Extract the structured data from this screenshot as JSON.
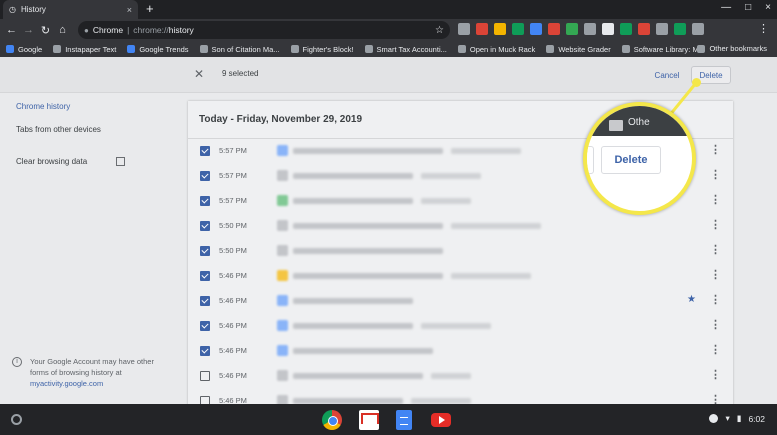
{
  "tab": {
    "title": "History",
    "close": "×",
    "new_tab": "+"
  },
  "window": {
    "controls": [
      "—",
      "□",
      "×"
    ]
  },
  "toolbar": {
    "back": "←",
    "forward": "→",
    "reload": "↻",
    "home": "⌂",
    "omnibox_label": "Chrome",
    "omnibox_scheme": "chrome://",
    "omnibox_path": "history",
    "star": "☆",
    "menu": "⋮"
  },
  "extensions": [
    "#9aa0a6",
    "#db4437",
    "#f4b400",
    "#0f9d58",
    "#4285f4",
    "#db4437",
    "#34a853",
    "#9aa0a6",
    "#e8eaed",
    "#0f9d58",
    "#db4437",
    "#9aa0a6",
    "#0f9d58",
    "#9aa0a6"
  ],
  "bookmarks": [
    {
      "label": "Google",
      "color": "#4285f4"
    },
    {
      "label": "Instapaper Text",
      "color": "#9aa0a6"
    },
    {
      "label": "Google Trends",
      "color": "#4285f4"
    },
    {
      "label": "Son of Citation Ma...",
      "color": "#9aa0a6"
    },
    {
      "label": "Fighter's Block!",
      "color": "#9aa0a6"
    },
    {
      "label": "Smart Tax Accounti...",
      "color": "#9aa0a6"
    },
    {
      "label": "Open in Muck Rack",
      "color": "#9aa0a6"
    },
    {
      "label": "Website Grader",
      "color": "#9aa0a6"
    },
    {
      "label": "Software Library: M...",
      "color": "#9aa0a6"
    }
  ],
  "other_bookmarks": "Other bookmarks",
  "selection": {
    "close": "✕",
    "count_label": "9 selected",
    "cancel": "Cancel",
    "delete": "Delete"
  },
  "sidebar": {
    "chrome_history": "Chrome history",
    "tabs_other_devices": "Tabs from other devices",
    "clear_data": "Clear browsing data",
    "account_note": "Your Google Account may have other forms of browsing history at",
    "account_link": "myactivity.google.com",
    "info_glyph": "i"
  },
  "history": {
    "date_header": "Today - Friday, November 29, 2019",
    "rows": [
      {
        "time": "5:57 PM",
        "checked": true,
        "starred": false,
        "fav": "#8ab4f8"
      },
      {
        "time": "5:57 PM",
        "checked": true,
        "starred": false,
        "fav": "#c3c5c9"
      },
      {
        "time": "5:57 PM",
        "checked": true,
        "starred": false,
        "fav": "#81c995"
      },
      {
        "time": "5:50 PM",
        "checked": true,
        "starred": false,
        "fav": "#c3c5c9"
      },
      {
        "time": "5:50 PM",
        "checked": true,
        "starred": false,
        "fav": "#c3c5c9"
      },
      {
        "time": "5:46 PM",
        "checked": true,
        "starred": false,
        "fav": "#f4c542"
      },
      {
        "time": "5:46 PM",
        "checked": true,
        "starred": true,
        "fav": "#8ab4f8"
      },
      {
        "time": "5:46 PM",
        "checked": true,
        "starred": false,
        "fav": "#8ab4f8"
      },
      {
        "time": "5:46 PM",
        "checked": true,
        "starred": false,
        "fav": "#8ab4f8"
      },
      {
        "time": "5:46 PM",
        "checked": false,
        "starred": false,
        "fav": "#c3c5c9"
      },
      {
        "time": "5:46 PM",
        "checked": false,
        "starred": false,
        "fav": "#c3c5c9"
      }
    ],
    "row_menu": "⋮",
    "star_glyph": "★"
  },
  "callout": {
    "other_label": "Othe",
    "delete_label": "Delete",
    "ring_color": "#f4e74a"
  },
  "shelf": {
    "time": "6:02"
  }
}
